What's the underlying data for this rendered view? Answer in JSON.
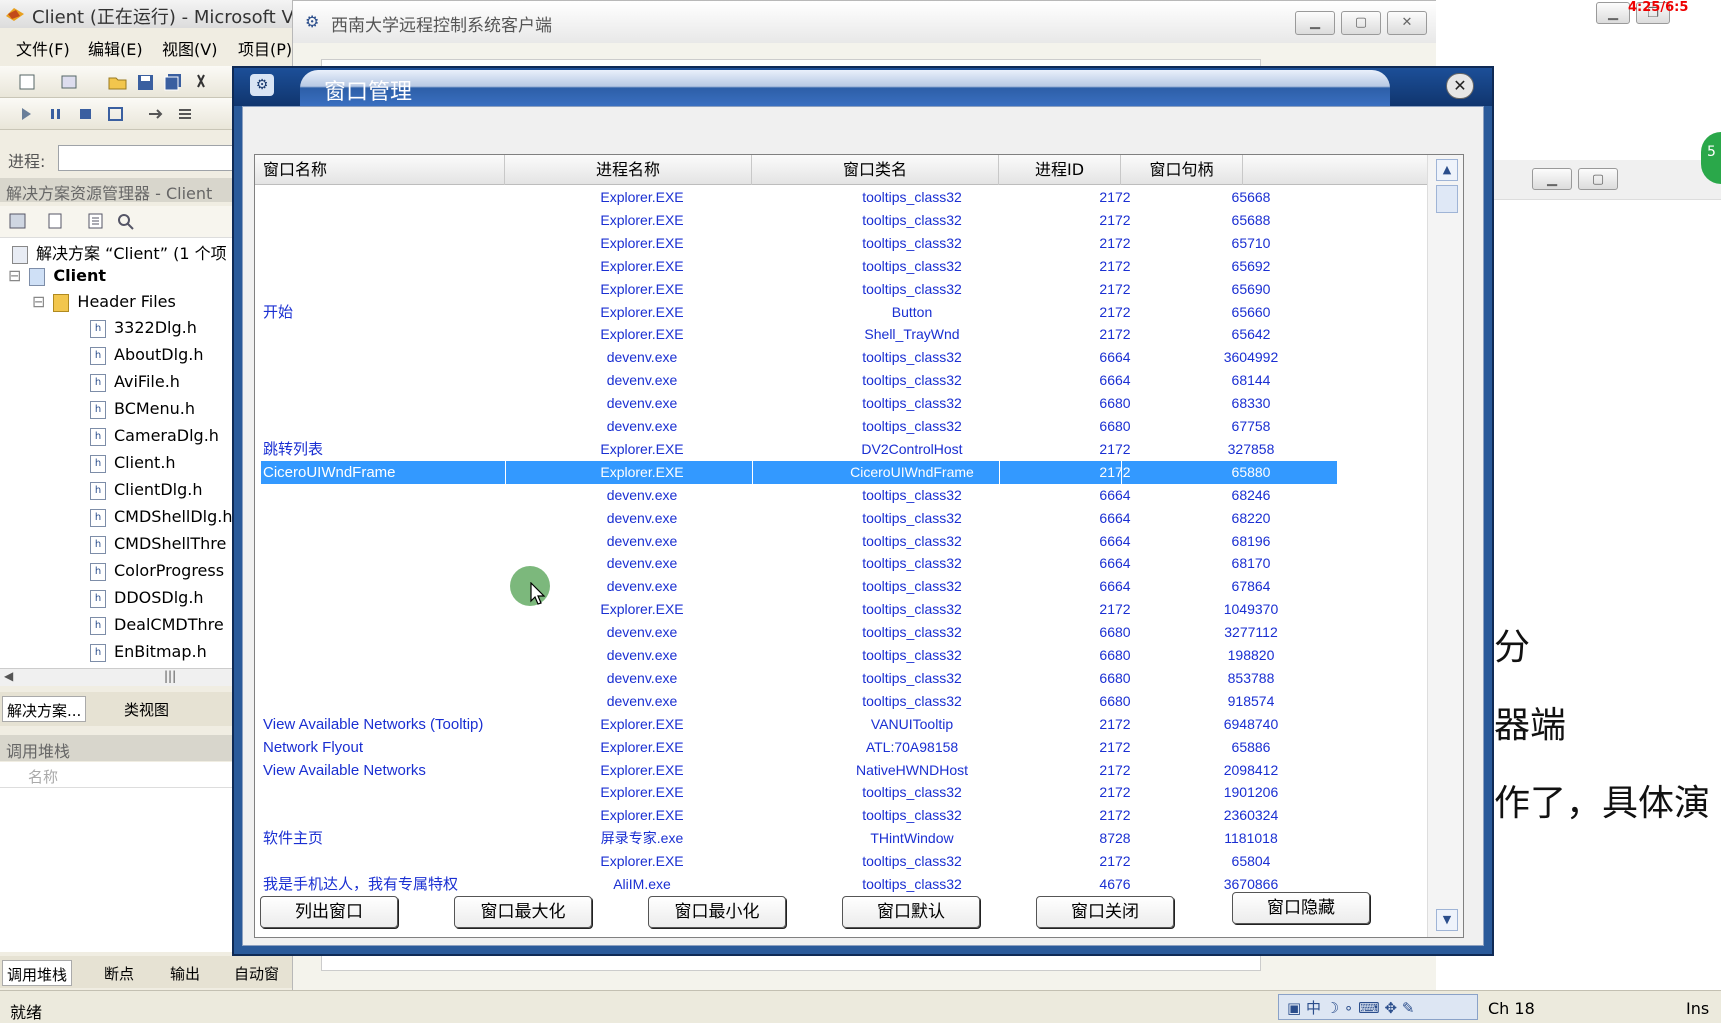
{
  "ide": {
    "title": "Client (正在运行) - Microsoft Visu",
    "menu": [
      "文件(F)",
      "编辑(E)",
      "视图(V)",
      "项目(P)"
    ],
    "process_label": "进程:",
    "solution_explorer_title": "解决方案资源管理器 - Client",
    "tree": {
      "solution": "解决方案 “Client” (1 个项",
      "project": "Client",
      "folder": "Header Files",
      "files": [
        "3322Dlg.h",
        "AboutDlg.h",
        "AviFile.h",
        "BCMenu.h",
        "CameraDlg.h",
        "Client.h",
        "ClientDlg.h",
        "CMDShellDlg.h",
        "CMDShellThre",
        "ColorProgress",
        "DDOSDlg.h",
        "DealCMDThre",
        "EnBitmap.h"
      ]
    },
    "panel_tabs": [
      "解决方案...",
      "类视图"
    ],
    "callstack_title": "调用堆栈",
    "callstack_col": "名称",
    "bottom_tabs": [
      "调用堆栈",
      "断点",
      "输出",
      "自动窗"
    ],
    "status": "就绪",
    "status_ch": "Ch 18",
    "status_ins": "Ins"
  },
  "client": {
    "title": "西南大学远程控制系统客户端"
  },
  "right": {
    "clock": "4:25/6:5",
    "badge": "5",
    "lines": [
      "分",
      "器端",
      "作了，具体演"
    ]
  },
  "dialog": {
    "title": "窗口管理",
    "close": "✕",
    "columns": [
      "窗口名称",
      "进程名称",
      "窗口类名",
      "进程ID",
      "窗口句柄"
    ],
    "rows": [
      [
        "",
        "Explorer.EXE",
        "tooltips_class32",
        "2172",
        "65668"
      ],
      [
        "",
        "Explorer.EXE",
        "tooltips_class32",
        "2172",
        "65688"
      ],
      [
        "",
        "Explorer.EXE",
        "tooltips_class32",
        "2172",
        "65710"
      ],
      [
        "",
        "Explorer.EXE",
        "tooltips_class32",
        "2172",
        "65692"
      ],
      [
        "",
        "Explorer.EXE",
        "tooltips_class32",
        "2172",
        "65690"
      ],
      [
        "开始",
        "Explorer.EXE",
        "Button",
        "2172",
        "65660"
      ],
      [
        "",
        "Explorer.EXE",
        "Shell_TrayWnd",
        "2172",
        "65642"
      ],
      [
        "",
        "devenv.exe",
        "tooltips_class32",
        "6664",
        "3604992"
      ],
      [
        "",
        "devenv.exe",
        "tooltips_class32",
        "6664",
        "68144"
      ],
      [
        "",
        "devenv.exe",
        "tooltips_class32",
        "6680",
        "68330"
      ],
      [
        "",
        "devenv.exe",
        "tooltips_class32",
        "6680",
        "67758"
      ],
      [
        "跳转列表",
        "Explorer.EXE",
        "DV2ControlHost",
        "2172",
        "327858"
      ],
      [
        "CiceroUIWndFrame",
        "Explorer.EXE",
        "CiceroUIWndFrame",
        "2172",
        "65880"
      ],
      [
        "",
        "devenv.exe",
        "tooltips_class32",
        "6664",
        "68246"
      ],
      [
        "",
        "devenv.exe",
        "tooltips_class32",
        "6664",
        "68220"
      ],
      [
        "",
        "devenv.exe",
        "tooltips_class32",
        "6664",
        "68196"
      ],
      [
        "",
        "devenv.exe",
        "tooltips_class32",
        "6664",
        "68170"
      ],
      [
        "",
        "devenv.exe",
        "tooltips_class32",
        "6664",
        "67864"
      ],
      [
        "",
        "Explorer.EXE",
        "tooltips_class32",
        "2172",
        "1049370"
      ],
      [
        "",
        "devenv.exe",
        "tooltips_class32",
        "6680",
        "3277112"
      ],
      [
        "",
        "devenv.exe",
        "tooltips_class32",
        "6680",
        "198820"
      ],
      [
        "",
        "devenv.exe",
        "tooltips_class32",
        "6680",
        "853788"
      ],
      [
        "",
        "devenv.exe",
        "tooltips_class32",
        "6680",
        "918574"
      ],
      [
        "View Available Networks (Tooltip)",
        "Explorer.EXE",
        "VANUITooltip",
        "2172",
        "6948740"
      ],
      [
        "Network Flyout",
        "Explorer.EXE",
        "ATL:70A98158",
        "2172",
        "65886"
      ],
      [
        "View Available Networks",
        "Explorer.EXE",
        "NativeHWNDHost",
        "2172",
        "2098412"
      ],
      [
        "",
        "Explorer.EXE",
        "tooltips_class32",
        "2172",
        "1901206"
      ],
      [
        "",
        "Explorer.EXE",
        "tooltips_class32",
        "2172",
        "2360324"
      ],
      [
        "软件主页",
        "屏录专家.exe",
        "THintWindow",
        "8728",
        "1181018"
      ],
      [
        "",
        "Explorer.EXE",
        "tooltips_class32",
        "2172",
        "65804"
      ],
      [
        "我是手机达人，我有专属特权",
        "AliIM.exe",
        "tooltips_class32",
        "4676",
        "3670866"
      ]
    ],
    "selected_row": 12,
    "buttons": {
      "list": "列出窗口",
      "max": "窗口最大化",
      "min": "窗口最小化",
      "default": "窗口默认",
      "close": "窗口关闭",
      "hide": "窗口隐藏"
    }
  },
  "colors": {
    "selection": "#3399ff",
    "text": "#1a2fd2",
    "dialog_frame": "#2a5a9a"
  }
}
